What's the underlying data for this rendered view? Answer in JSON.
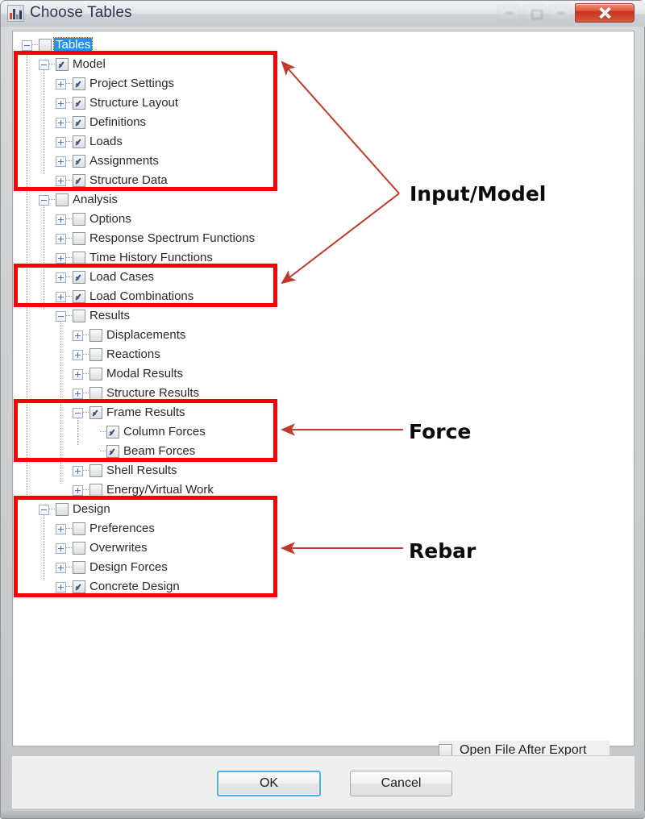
{
  "window": {
    "title": "Choose Tables",
    "icon": "bar-chart-icon",
    "controls": {
      "minimize": "minimize-button",
      "maximize": "maximize-button",
      "restore": "restore-button",
      "close": "close-button"
    }
  },
  "tree": {
    "root": {
      "label": "Tables",
      "checked": false,
      "selected": true,
      "expanded": true
    },
    "nodes": [
      {
        "label": "Model",
        "level": 1,
        "checked": true,
        "toggle": "minus"
      },
      {
        "label": "Project Settings",
        "level": 2,
        "checked": true,
        "toggle": "plus"
      },
      {
        "label": "Structure Layout",
        "level": 2,
        "checked": true,
        "toggle": "plus"
      },
      {
        "label": "Definitions",
        "level": 2,
        "checked": true,
        "toggle": "plus"
      },
      {
        "label": "Loads",
        "level": 2,
        "checked": true,
        "toggle": "plus"
      },
      {
        "label": "Assignments",
        "level": 2,
        "checked": true,
        "toggle": "plus"
      },
      {
        "label": "Structure Data",
        "level": 2,
        "checked": true,
        "toggle": "plus"
      },
      {
        "label": "Analysis",
        "level": 1,
        "checked": false,
        "toggle": "minus"
      },
      {
        "label": "Options",
        "level": 2,
        "checked": false,
        "toggle": "plus"
      },
      {
        "label": "Response Spectrum Functions",
        "level": 2,
        "checked": false,
        "toggle": "plus"
      },
      {
        "label": "Time History Functions",
        "level": 2,
        "checked": false,
        "toggle": "plus"
      },
      {
        "label": "Load Cases",
        "level": 2,
        "checked": true,
        "toggle": "plus"
      },
      {
        "label": "Load Combinations",
        "level": 2,
        "checked": true,
        "toggle": "plus"
      },
      {
        "label": "Results",
        "level": 2,
        "checked": false,
        "toggle": "minus"
      },
      {
        "label": "Displacements",
        "level": 3,
        "checked": false,
        "toggle": "plus"
      },
      {
        "label": "Reactions",
        "level": 3,
        "checked": false,
        "toggle": "plus"
      },
      {
        "label": "Modal Results",
        "level": 3,
        "checked": false,
        "toggle": "plus"
      },
      {
        "label": "Structure Results",
        "level": 3,
        "checked": false,
        "toggle": "plus"
      },
      {
        "label": "Frame Results",
        "level": 3,
        "checked": true,
        "toggle": "minus"
      },
      {
        "label": "Column Forces",
        "level": 4,
        "checked": true,
        "toggle": "leaf"
      },
      {
        "label": "Beam Forces",
        "level": 4,
        "checked": true,
        "toggle": "leaf"
      },
      {
        "label": "Shell Results",
        "level": 3,
        "checked": false,
        "toggle": "plus"
      },
      {
        "label": "Energy/Virtual Work",
        "level": 3,
        "checked": false,
        "toggle": "plus"
      },
      {
        "label": "Design",
        "level": 1,
        "checked": false,
        "toggle": "minus"
      },
      {
        "label": "Preferences",
        "level": 2,
        "checked": false,
        "toggle": "plus"
      },
      {
        "label": "Overwrites",
        "level": 2,
        "checked": false,
        "toggle": "plus"
      },
      {
        "label": "Design Forces",
        "level": 2,
        "checked": false,
        "toggle": "plus"
      },
      {
        "label": "Concrete Design",
        "level": 2,
        "checked": true,
        "toggle": "plus"
      }
    ]
  },
  "options": {
    "open_file_after_export": {
      "label": "Open File After Export",
      "checked": false
    }
  },
  "buttons": {
    "ok": "OK",
    "cancel": "Cancel"
  },
  "annotations": {
    "accent_color": "#fb0007",
    "arrow_color": "#c0392b",
    "items": [
      {
        "label": "Input/Model",
        "targets": [
          "model-group",
          "load-cases-group"
        ]
      },
      {
        "label": "Force",
        "targets": [
          "frame-results-group"
        ]
      },
      {
        "label": "Rebar",
        "targets": [
          "design-group"
        ]
      }
    ],
    "highlight_boxes": [
      {
        "name": "model-group",
        "first": "Model",
        "last": "Structure Data"
      },
      {
        "name": "load-cases-group",
        "first": "Load Cases",
        "last": "Load Combinations"
      },
      {
        "name": "frame-results-group",
        "first": "Frame Results",
        "last": "Beam Forces"
      },
      {
        "name": "design-group",
        "first": "Design",
        "last": "Concrete Design"
      }
    ]
  }
}
